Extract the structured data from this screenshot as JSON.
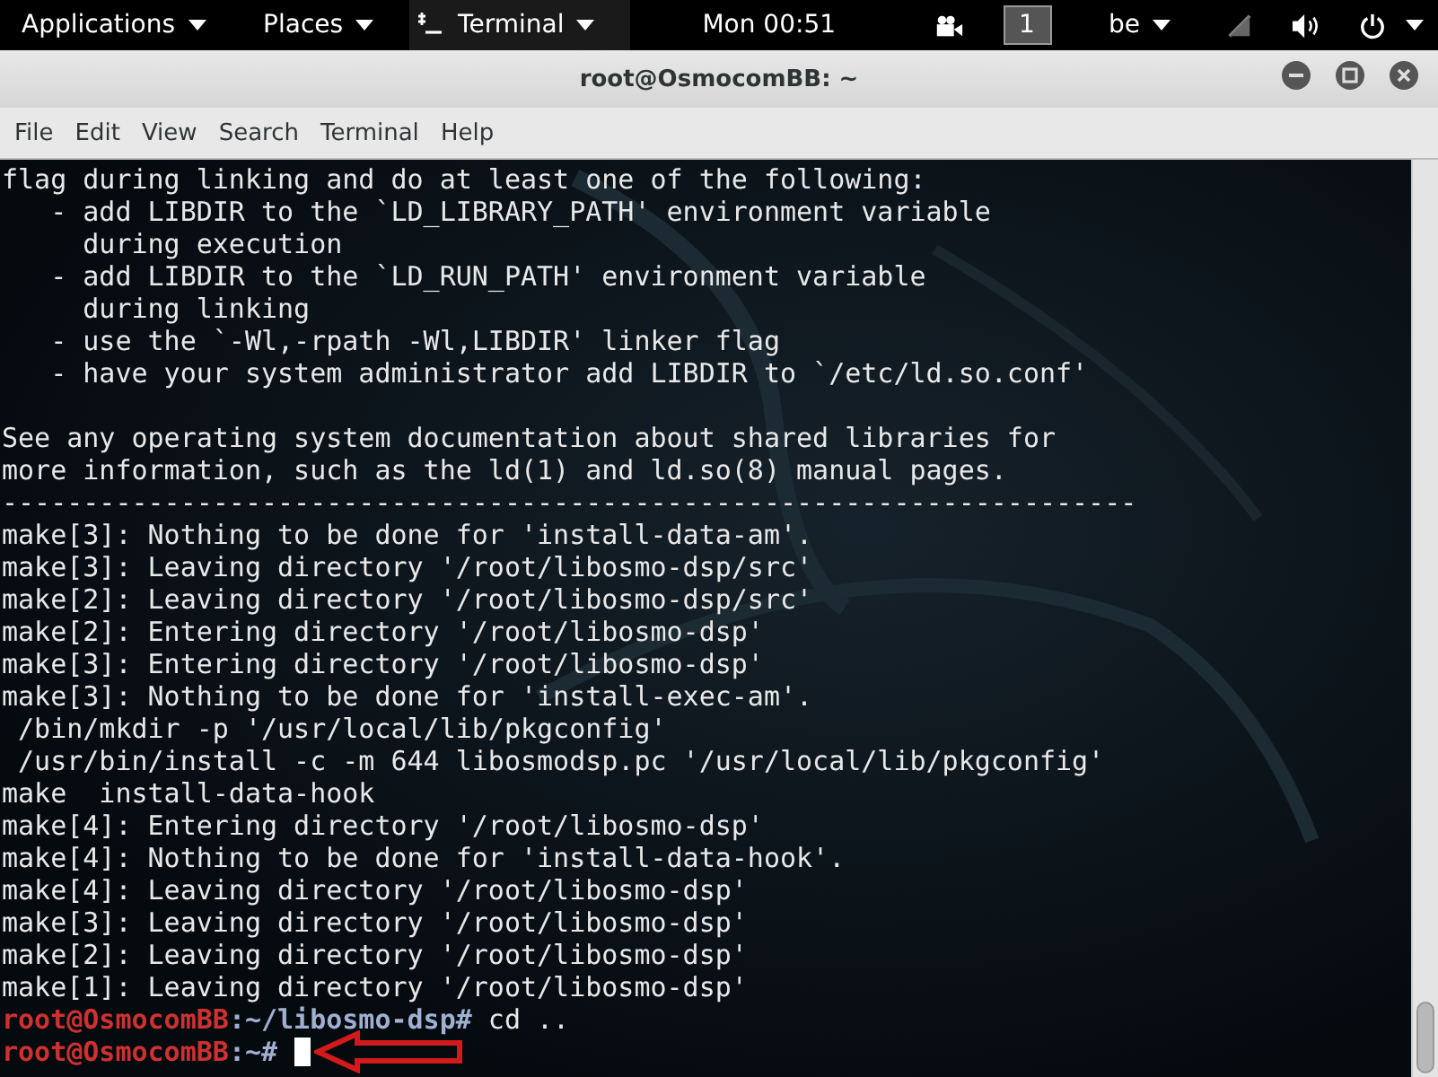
{
  "top_bar": {
    "menus": [
      "Applications",
      "Places"
    ],
    "app_menu": "Terminal",
    "clock": "Mon 00:51",
    "workspace": "1",
    "keyboard_layout": "be"
  },
  "window": {
    "title": "root@OsmocomBB: ~"
  },
  "menu_bar": [
    "File",
    "Edit",
    "View",
    "Search",
    "Terminal",
    "Help"
  ],
  "terminal": {
    "lines": [
      {
        "kind": "output",
        "text": "flag during linking and do at least one of the following:"
      },
      {
        "kind": "output",
        "text": "   - add LIBDIR to the `LD_LIBRARY_PATH' environment variable"
      },
      {
        "kind": "output",
        "text": "     during execution"
      },
      {
        "kind": "output",
        "text": "   - add LIBDIR to the `LD_RUN_PATH' environment variable"
      },
      {
        "kind": "output",
        "text": "     during linking"
      },
      {
        "kind": "output",
        "text": "   - use the `-Wl,-rpath -Wl,LIBDIR' linker flag"
      },
      {
        "kind": "output",
        "text": "   - have your system administrator add LIBDIR to `/etc/ld.so.conf'"
      },
      {
        "kind": "blank"
      },
      {
        "kind": "output",
        "text": "See any operating system documentation about shared libraries for"
      },
      {
        "kind": "output",
        "text": "more information, such as the ld(1) and ld.so(8) manual pages."
      },
      {
        "kind": "output",
        "text": "----------------------------------------------------------------------"
      },
      {
        "kind": "output",
        "text": "make[3]: Nothing to be done for 'install-data-am'."
      },
      {
        "kind": "output",
        "text": "make[3]: Leaving directory '/root/libosmo-dsp/src'"
      },
      {
        "kind": "output",
        "text": "make[2]: Leaving directory '/root/libosmo-dsp/src'"
      },
      {
        "kind": "output",
        "text": "make[2]: Entering directory '/root/libosmo-dsp'"
      },
      {
        "kind": "output",
        "text": "make[3]: Entering directory '/root/libosmo-dsp'"
      },
      {
        "kind": "output",
        "text": "make[3]: Nothing to be done for 'install-exec-am'."
      },
      {
        "kind": "output",
        "text": " /bin/mkdir -p '/usr/local/lib/pkgconfig'"
      },
      {
        "kind": "output",
        "text": " /usr/bin/install -c -m 644 libosmodsp.pc '/usr/local/lib/pkgconfig'"
      },
      {
        "kind": "output",
        "text": "make  install-data-hook"
      },
      {
        "kind": "output",
        "text": "make[4]: Entering directory '/root/libosmo-dsp'"
      },
      {
        "kind": "output",
        "text": "make[4]: Nothing to be done for 'install-data-hook'."
      },
      {
        "kind": "output",
        "text": "make[4]: Leaving directory '/root/libosmo-dsp'"
      },
      {
        "kind": "output",
        "text": "make[3]: Leaving directory '/root/libosmo-dsp'"
      },
      {
        "kind": "output",
        "text": "make[2]: Leaving directory '/root/libosmo-dsp'"
      },
      {
        "kind": "output",
        "text": "make[1]: Leaving directory '/root/libosmo-dsp'"
      },
      {
        "kind": "prompt",
        "user_host": "root@OsmocomBB",
        "path": ":~/libosmo-dsp#",
        "command": " cd ..",
        "cursor": false
      },
      {
        "kind": "prompt",
        "user_host": "root@OsmocomBB",
        "path": ":~#",
        "cursor": true
      }
    ]
  }
}
